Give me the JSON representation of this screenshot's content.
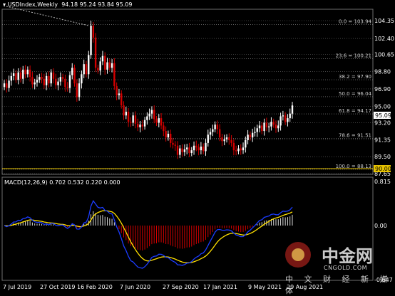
{
  "header": {
    "symbol_label": "USDIndex,Weekly",
    "ohlc": "94.18 95.24 93.84 95.09"
  },
  "colors": {
    "background": "#000000",
    "bull": "#ffffff",
    "bear": "#d40000",
    "grid": "#6e6e6e",
    "signal": "#ffe000",
    "macd_line": "#1b3cff",
    "hline": "#e6c200"
  },
  "price_axis": {
    "ticks": [
      "104.35",
      "102.40",
      "100.65",
      "98.80",
      "96.90",
      "95.00",
      "93.20",
      "91.35",
      "89.50",
      "87.65"
    ],
    "current_price": "95.09",
    "hline_label": "90.00"
  },
  "fib_levels": [
    {
      "label": "0.0 = 103.94",
      "value": 103.94
    },
    {
      "label": "23.6 = 100.21",
      "value": 100.21
    },
    {
      "label": "38.2 = 97.90",
      "value": 97.9
    },
    {
      "label": "50.0 = 96.04",
      "value": 96.04
    },
    {
      "label": "61.8 = 94.17",
      "value": 94.17
    },
    {
      "label": "78.6 = 91.51",
      "value": 91.51
    },
    {
      "label": "100.0 = 88.13",
      "value": 88.13
    }
  ],
  "macd": {
    "title": "MACD(12,26,9) 0.702 0.532 0.220 0.000",
    "scale_top": "0.815",
    "scale_zero": "0.00",
    "scale_bottom": "-0.647"
  },
  "time_axis": {
    "labels": [
      "7 Jul 2019",
      "27 Oct 2019",
      "16 Feb 2020",
      "7 Jun 2020",
      "27 Sep 2020",
      "17 Jan 2021",
      "9 May 2021",
      "29 Aug 2021"
    ]
  },
  "watermark": {
    "brand_cn": "中金网",
    "brand_en": "CNGOLD.COM",
    "tagline": "中 文 财 经 新 媒 体"
  },
  "chart_data": {
    "type": "candlestick",
    "closes": [
      97.5,
      97.0,
      97.8,
      98.3,
      98.6,
      97.9,
      98.7,
      98.0,
      99.0,
      98.5,
      99.0,
      98.2,
      97.4,
      97.6,
      97.9,
      98.2,
      98.0,
      97.3,
      98.3,
      97.5,
      98.7,
      98.0,
      97.3,
      97.7,
      98.2,
      98.0,
      97.1,
      97.0,
      98.4,
      99.2,
      97.5,
      96.0,
      97.5,
      98.5,
      99.6,
      98.5,
      100.6,
      103.8,
      102.5,
      99.2,
      98.9,
      99.9,
      100.5,
      99.0,
      99.8,
      99.2,
      99.7,
      97.2,
      96.2,
      96.4,
      95.1,
      94.0,
      94.4,
      93.3,
      93.2,
      94.0,
      93.1,
      92.7,
      93.0,
      92.8,
      93.5,
      93.9,
      94.2,
      94.6,
      93.6,
      93.2,
      93.7,
      92.9,
      92.3,
      91.6,
      92.0,
      91.0,
      90.8,
      90.7,
      89.7,
      90.4,
      90.0,
      90.3,
      90.5,
      89.9,
      90.2,
      90.7,
      90.5,
      90.2,
      90.6,
      90.1,
      91.0,
      91.9,
      92.2,
      92.5,
      93.0,
      92.5,
      91.6,
      91.2,
      91.4,
      91.6,
      91.3,
      91.0,
      90.2,
      90.1,
      90.4,
      90.2,
      90.5,
      91.3,
      91.9,
      91.6,
      92.1,
      92.2,
      92.6,
      92.9,
      92.3,
      93.2,
      92.7,
      92.8,
      93.3,
      93.0,
      92.6,
      92.9,
      93.9,
      94.0,
      93.3,
      93.7,
      94.2,
      95.09
    ]
  }
}
